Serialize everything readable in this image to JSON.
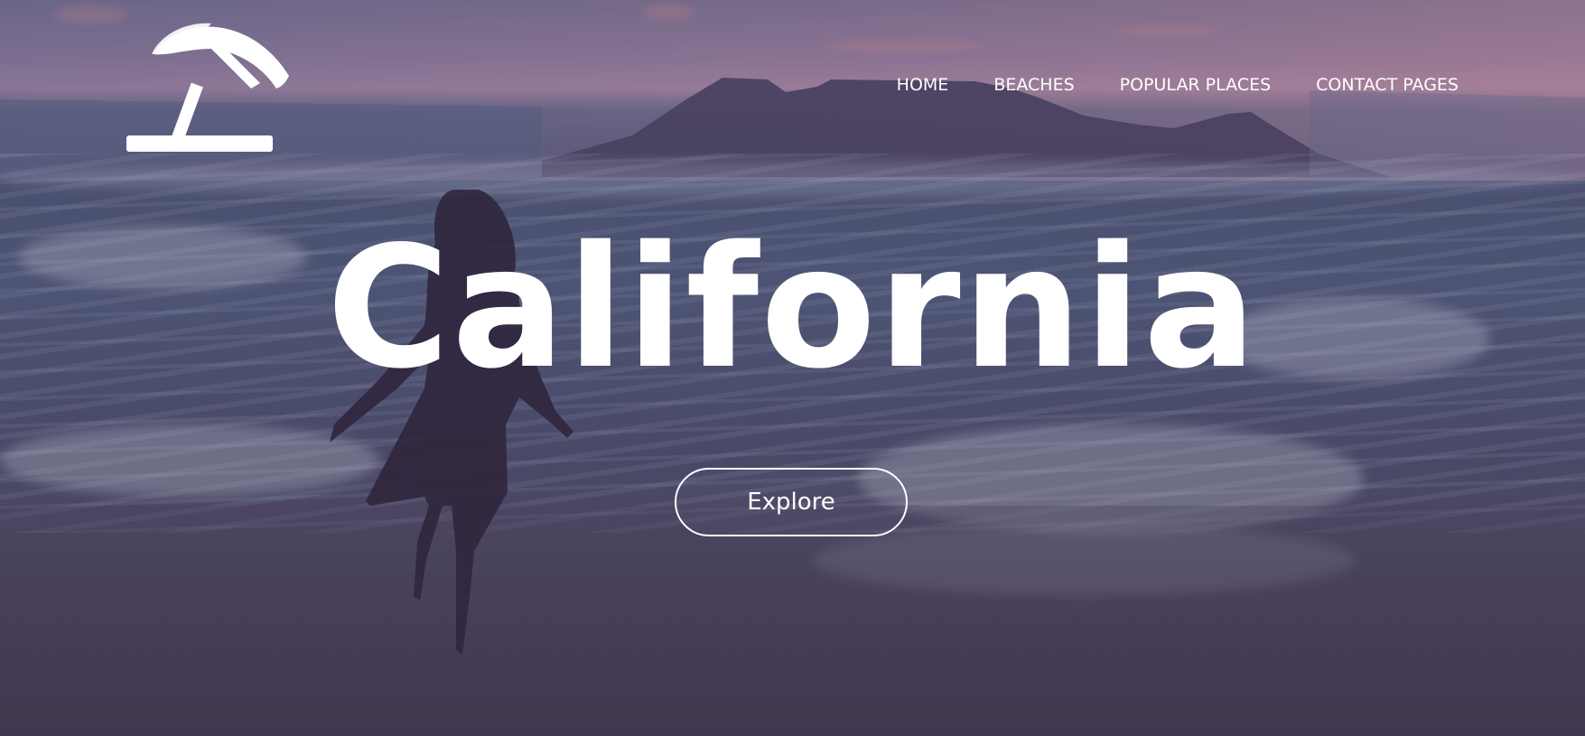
{
  "logo": {
    "icon": "beach-umbrella-icon"
  },
  "nav": {
    "items": [
      {
        "label": "HOME"
      },
      {
        "label": "BEACHES"
      },
      {
        "label": "POPULAR PLACES"
      },
      {
        "label": "CONTACT PAGES"
      }
    ]
  },
  "hero": {
    "title": "California",
    "cta_label": "Explore"
  },
  "colors": {
    "text": "#ffffff",
    "overlay": "#46375a"
  }
}
